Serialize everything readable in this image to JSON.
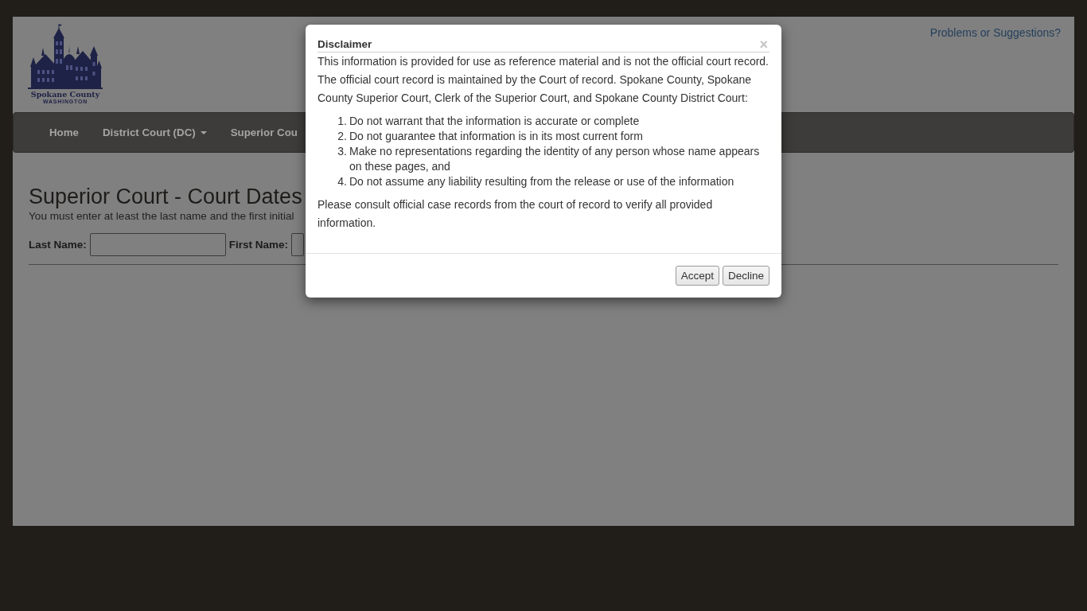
{
  "header": {
    "logo": {
      "title": "Spokane County",
      "subtitle": "WASHINGTON"
    },
    "feedback_link": "Problems or Suggestions?"
  },
  "nav": {
    "items": [
      {
        "label": "Home",
        "dropdown": false
      },
      {
        "label": "District Court (DC)",
        "dropdown": true
      },
      {
        "label": "Superior Cou",
        "dropdown": false
      }
    ]
  },
  "content": {
    "title": "Superior Court - Court Dates",
    "instructions": "You must enter at least the last name and the first initial",
    "fields": [
      {
        "label": "Last Name:"
      },
      {
        "label": "First Name:"
      }
    ]
  },
  "dialog": {
    "title": "Disclaimer",
    "close": "×",
    "intro": "This information is provided for use as reference material and is not the official court record. The official court record is maintained by the Court of record. Spokane County, Spokane County Superior Court, Clerk of the Superior Court, and Spokane County District Court:",
    "points": [
      {
        "number": "1.",
        "text": "Do not warrant that the information is accurate or complete"
      },
      {
        "number": "2.",
        "text": "Do not guarantee that information is in its most current form"
      },
      {
        "number": "3.",
        "text": "Make no representations regarding the identity of any person whose name appears on these pages, and"
      },
      {
        "number": "4.",
        "text": "Do not assume any liability resulting from the release or use of the information"
      }
    ],
    "note": "Please consult official case records from the court of record to verify all provided information.",
    "buttons": [
      {
        "label": "Accept"
      },
      {
        "label": "Decline"
      }
    ]
  }
}
